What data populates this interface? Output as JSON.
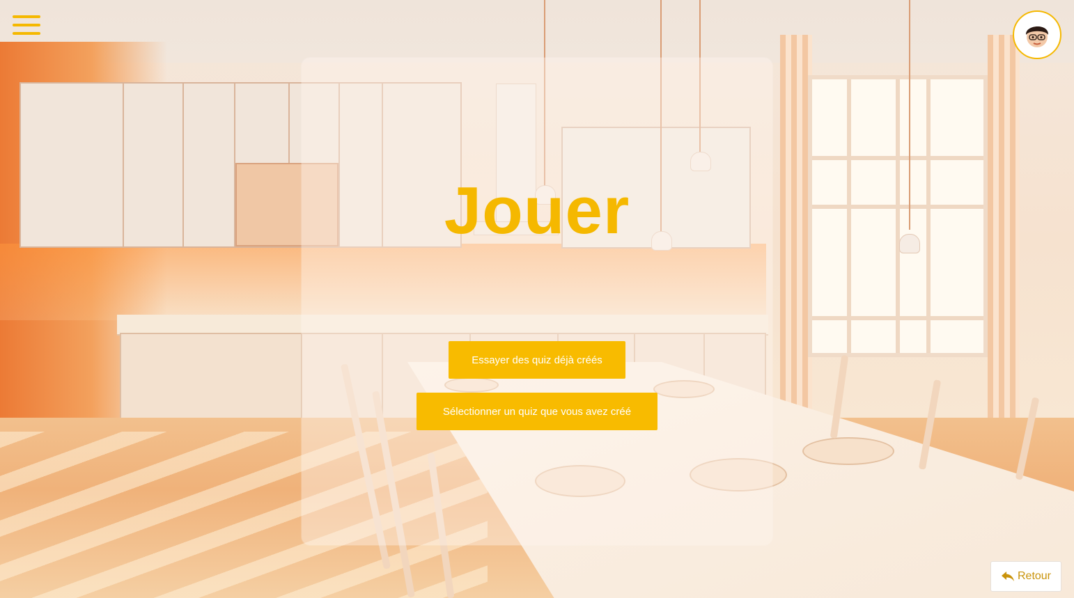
{
  "page": {
    "title": "Jouer"
  },
  "menu": {
    "icon": "hamburger-menu-icon"
  },
  "user": {
    "avatar_icon": "user-avatar-icon"
  },
  "actions": {
    "try_existing_label": "Essayer des quiz déjà créés",
    "select_own_label": "Sélectionner un quiz que vous avez créé"
  },
  "footer": {
    "back_label": "Retour",
    "back_icon": "reply-arrow-icon"
  },
  "colors": {
    "accent": "#f5b800",
    "button": "#f8bb00",
    "button_text": "#ffffff",
    "back_text": "#c9930a"
  }
}
